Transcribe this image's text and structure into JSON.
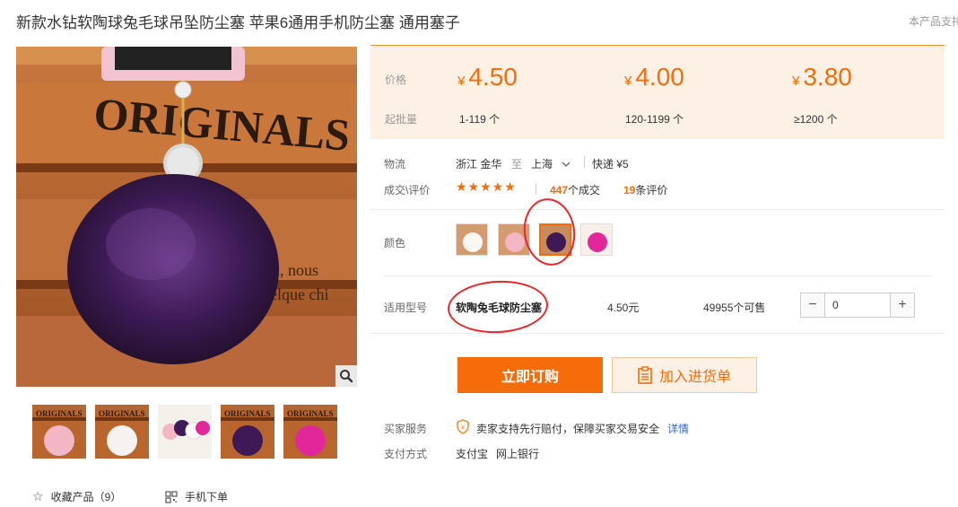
{
  "header": {
    "title": "新款水钻软陶球兔毛球吊坠防尘塞 苹果6通用手机防尘塞 通用塞子",
    "support_text": "本产品支持"
  },
  "gallery": {
    "main_image_text": "ORIGINALS",
    "main_image_sub1": "prix, nous",
    "main_image_sub2": "quelque chi",
    "thumbnail_text": "ORIGINALS"
  },
  "bottom_links": {
    "favorite_label": "收藏产品（9）",
    "mobile_order_label": "手机下单"
  },
  "price_box": {
    "price_label": "价格",
    "moq_label": "起批量",
    "currency": "¥",
    "tiers": [
      {
        "price": "4.50",
        "moq": "1-119 个"
      },
      {
        "price": "4.00",
        "moq": "120-1199 个"
      },
      {
        "price": "3.80",
        "moq": "≥1200 个"
      }
    ]
  },
  "logistics": {
    "label": "物流",
    "from": "浙江 金华",
    "to_word": "至",
    "destination": "上海",
    "shipping": "快递 ¥5"
  },
  "deals": {
    "label": "成交\\评价",
    "stars": "★★★★★",
    "deal_count": "447",
    "deal_suffix": "个成交",
    "review_count": "19",
    "review_suffix": "条评价"
  },
  "color": {
    "label": "颜色",
    "swatches": [
      "pink",
      "white",
      "purple",
      "magenta"
    ],
    "selected_index": 2
  },
  "model": {
    "label": "适用型号",
    "name": "软陶兔毛球防尘塞",
    "price": "4.50元",
    "stock": "49955个可售",
    "quantity": "0",
    "minus": "−",
    "plus": "+"
  },
  "actions": {
    "buy_label": "立即订购",
    "cart_label": "加入进货单"
  },
  "service": {
    "label": "买家服务",
    "text": "卖家支持先行赔付，保障买家交易安全",
    "detail_link": "详情"
  },
  "payment": {
    "label": "支付方式",
    "methods": [
      "支付宝",
      "网上银行"
    ]
  },
  "colors": {
    "accent": "#f56c0a",
    "price_bg": "#fdf1e6",
    "annotation_red": "#e8262b"
  }
}
